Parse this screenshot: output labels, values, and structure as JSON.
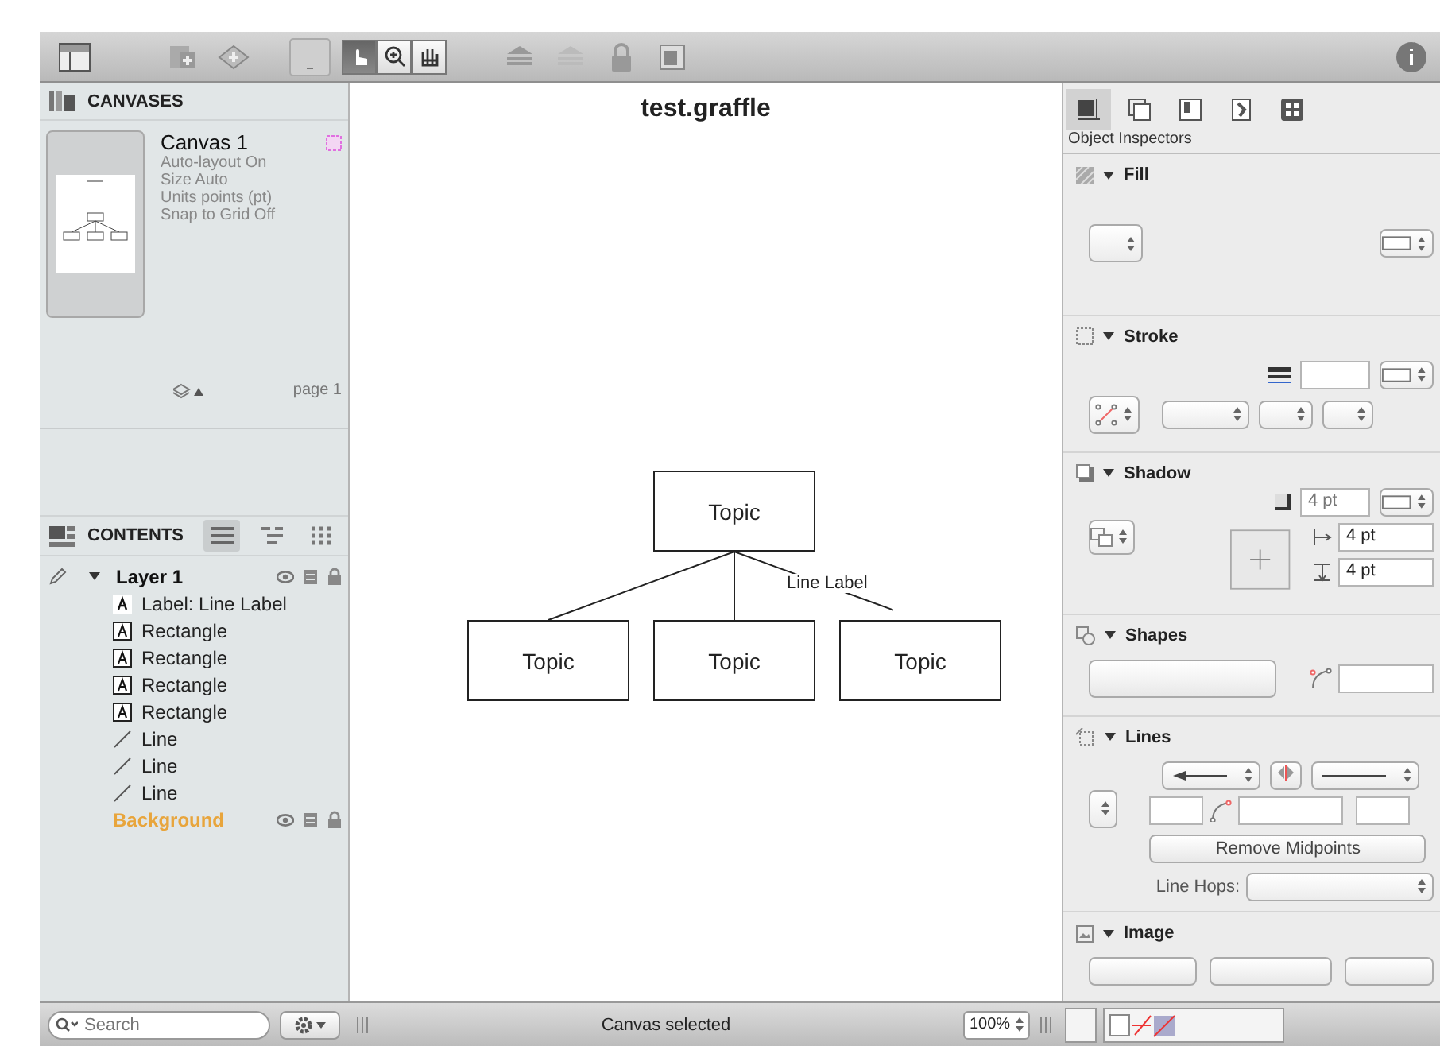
{
  "toolbar": {
    "tools": [
      {
        "selected": true
      },
      {
        "selected": false
      },
      {
        "selected": false
      }
    ]
  },
  "canvases": {
    "title": "CANVASES",
    "items": [
      {
        "name": "Canvas 1",
        "selected": true,
        "details": [
          "Auto-layout On",
          "Size Auto",
          "Units points (pt)",
          "Snap to Grid Off"
        ],
        "page": "page 1"
      }
    ]
  },
  "contents": {
    "title": "CONTENTS",
    "views": [
      {
        "selected": true
      },
      {
        "selected": false
      },
      {
        "selected": false
      }
    ],
    "layers": [
      {
        "name": "Layer 1",
        "color": "#111111",
        "expanded": true,
        "children": [
          {
            "kind": "label",
            "name": "Label: Line Label"
          },
          {
            "kind": "shape",
            "name": "Rectangle"
          },
          {
            "kind": "shape",
            "name": "Rectangle"
          },
          {
            "kind": "shape",
            "name": "Rectangle"
          },
          {
            "kind": "shape",
            "name": "Rectangle"
          },
          {
            "kind": "line",
            "name": "Line"
          },
          {
            "kind": "line",
            "name": "Line"
          },
          {
            "kind": "line",
            "name": "Line"
          }
        ]
      },
      {
        "name": "Background",
        "color": "#e8a53c"
      }
    ]
  },
  "canvas": {
    "title": "test.graffle",
    "root": "Topic",
    "children": [
      "Topic",
      "Topic",
      "Topic"
    ],
    "line_label": "Line Label"
  },
  "inspector": {
    "tabs": [
      {
        "selected": true
      },
      {
        "selected": false
      },
      {
        "selected": false
      },
      {
        "selected": false
      },
      {
        "selected": false
      }
    ],
    "title": "Object Inspectors",
    "sections": [
      {
        "kind": "fill",
        "title": "Fill",
        "expanded": true
      },
      {
        "kind": "stroke",
        "title": "Stroke",
        "expanded": true
      },
      {
        "kind": "shadow",
        "title": "Shadow",
        "expanded": true,
        "values": [
          "4 pt",
          "4 pt",
          "4 pt"
        ]
      },
      {
        "kind": "shapes",
        "title": "Shapes",
        "expanded": true
      },
      {
        "kind": "lines",
        "title": "Lines",
        "expanded": true,
        "button": "Remove Midpoints",
        "hops_label": "Line Hops:"
      },
      {
        "kind": "image",
        "title": "Image",
        "expanded": true
      }
    ]
  },
  "status_bar": {
    "search_placeholder": "Search",
    "status": "Canvas selected",
    "zoom": "100%"
  }
}
